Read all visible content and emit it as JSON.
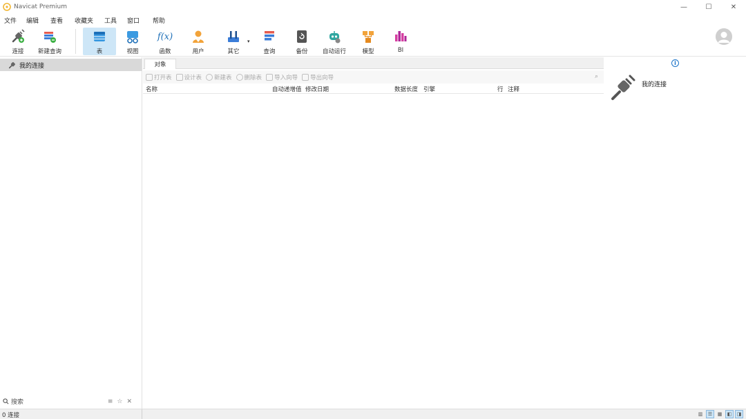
{
  "window": {
    "title": "Navicat Premium",
    "controls": {
      "minimize": "—",
      "maximize": "☐",
      "close": "✕"
    }
  },
  "menu": [
    "文件",
    "编辑",
    "查看",
    "收藏夹",
    "工具",
    "窗口",
    "帮助"
  ],
  "toolbar": {
    "buttons": [
      {
        "label": "连接",
        "icon": "plug-icon"
      },
      {
        "label": "新建查询",
        "icon": "new-query-icon"
      },
      {
        "label": "表",
        "icon": "table-icon",
        "active": true
      },
      {
        "label": "视图",
        "icon": "view-icon"
      },
      {
        "label": "函数",
        "icon": "function-icon",
        "glyph": "f(x)"
      },
      {
        "label": "用户",
        "icon": "user-icon"
      },
      {
        "label": "其它",
        "icon": "tools-icon"
      },
      {
        "label": "查询",
        "icon": "query-icon"
      },
      {
        "label": "备份",
        "icon": "backup-icon"
      },
      {
        "label": "自动运行",
        "icon": "robot-icon"
      },
      {
        "label": "模型",
        "icon": "model-icon"
      },
      {
        "label": "BI",
        "icon": "bi-icon"
      }
    ],
    "caret": "▾"
  },
  "sidebar": {
    "connection": "我的连接",
    "search_label": "搜索",
    "tools": [
      "≡",
      "☆",
      "✕"
    ]
  },
  "center": {
    "tab": "对象",
    "object_toolbar": [
      "打开表",
      "设计表",
      "新建表",
      "删除表",
      "导入向导",
      "导出向导"
    ],
    "search_icon": "⌕",
    "columns": [
      "名称",
      "自动递增值",
      "修改日期",
      "数据长度",
      "引擎",
      "行",
      "注释"
    ]
  },
  "info_panel": {
    "info_glyph": "i",
    "title": "我的连接"
  },
  "status": {
    "text": "0 连接",
    "view_glyphs": [
      "▥",
      "☰",
      "▦"
    ]
  },
  "colors": {
    "accent": "#1a73c8",
    "active_bg": "#cde6f7",
    "selection_bg": "#d9d9d9"
  }
}
